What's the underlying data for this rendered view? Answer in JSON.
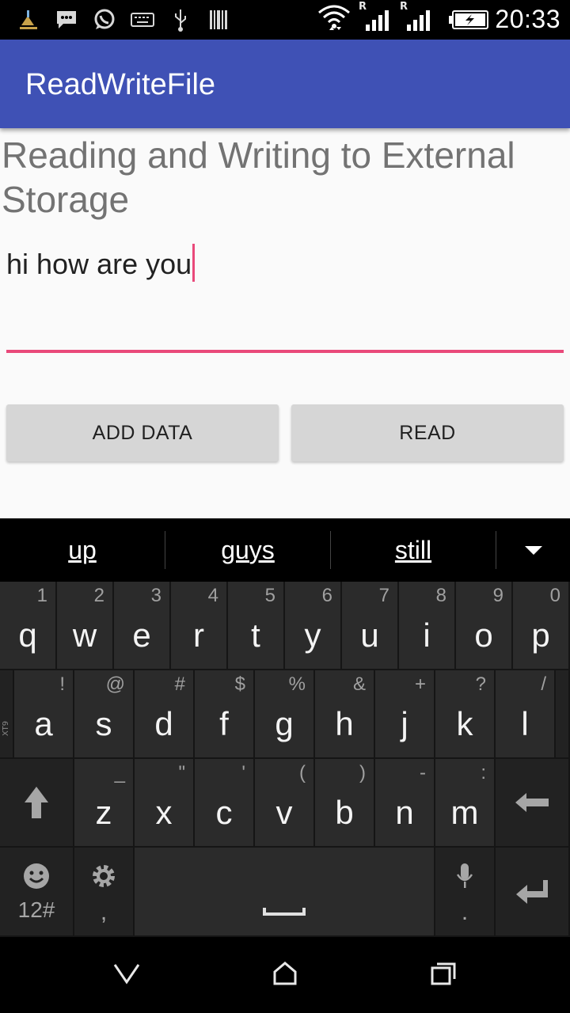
{
  "status_bar": {
    "time": "20:33",
    "icons": [
      "cleaner-icon",
      "message-icon",
      "whatsapp-icon",
      "keyboard-icon",
      "usb-icon",
      "barcode-icon",
      "wifi-icon",
      "signal-icon",
      "signal-icon",
      "battery-charging-icon"
    ],
    "roaming_1": "R",
    "roaming_2": "R"
  },
  "toolbar": {
    "title": "ReadWriteFile",
    "color": "#3f51b5"
  },
  "content": {
    "heading": "Reading and Writing to External Storage",
    "edit_text": "hi how are you",
    "accent": "#e9497a",
    "add_button": "ADD DATA",
    "read_button": "READ"
  },
  "keyboard": {
    "suggestions": [
      "up",
      "guys",
      "still"
    ],
    "row1": [
      {
        "k": "q",
        "h": "1"
      },
      {
        "k": "w",
        "h": "2"
      },
      {
        "k": "e",
        "h": "3"
      },
      {
        "k": "r",
        "h": "4"
      },
      {
        "k": "t",
        "h": "5"
      },
      {
        "k": "y",
        "h": "6"
      },
      {
        "k": "u",
        "h": "7"
      },
      {
        "k": "i",
        "h": "8"
      },
      {
        "k": "o",
        "h": "9"
      },
      {
        "k": "p",
        "h": "0"
      }
    ],
    "row2": [
      {
        "k": "a",
        "h": "!"
      },
      {
        "k": "s",
        "h": "@"
      },
      {
        "k": "d",
        "h": "#"
      },
      {
        "k": "f",
        "h": "$"
      },
      {
        "k": "g",
        "h": "%"
      },
      {
        "k": "h",
        "h": "&"
      },
      {
        "k": "j",
        "h": "+"
      },
      {
        "k": "k",
        "h": "?"
      },
      {
        "k": "l",
        "h": "/"
      }
    ],
    "row3": [
      {
        "k": "z",
        "h": "_"
      },
      {
        "k": "x",
        "h": "\""
      },
      {
        "k": "c",
        "h": "'"
      },
      {
        "k": "v",
        "h": "("
      },
      {
        "k": "b",
        "h": ")"
      },
      {
        "k": "n",
        "h": "-"
      },
      {
        "k": "m",
        "h": ":"
      }
    ],
    "side_label": "XT9",
    "symbols_label": "12#",
    "comma_label": ",",
    "period_label": "."
  },
  "nav_bar": {
    "icons": [
      "back-icon",
      "home-icon",
      "recents-icon"
    ]
  }
}
